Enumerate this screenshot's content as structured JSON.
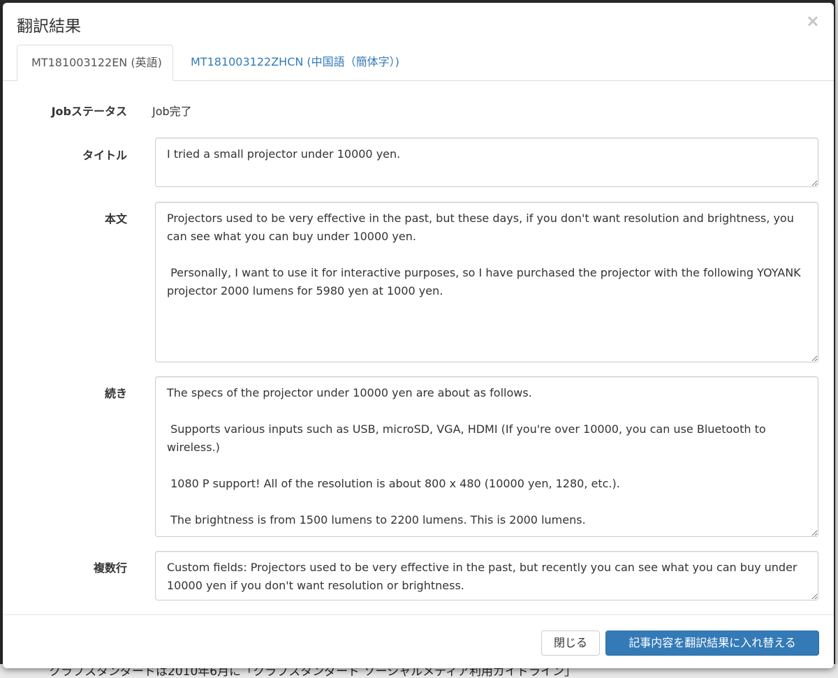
{
  "backdrop": {
    "text": "クラブスタンダードは2010年6月に「クラブスタンダード ソーシャルメディア利用ガイドライン」"
  },
  "modal": {
    "title": "翻訳結果",
    "close_symbol": "×"
  },
  "tabs": [
    {
      "label": "MT181003122EN (英語)",
      "active": true
    },
    {
      "label": "MT181003122ZHCN (中国語（簡体字）)",
      "active": false
    }
  ],
  "form": {
    "job_status": {
      "label": "Jobステータス",
      "value": "Job完了"
    },
    "title": {
      "label": "タイトル",
      "value": "I tried a small projector under 10000 yen."
    },
    "body": {
      "label": "本文",
      "value": "Projectors used to be very effective in the past, but these days, if you don't want resolution and brightness, you can see what you can buy under 10000 yen.\n\n Personally, I want to use it for interactive purposes, so I have purchased the projector with the following YOYANK projector 2000 lumens for 5980 yen at 1000 yen."
    },
    "continuation": {
      "label": "続き",
      "value": "The specs of the projector under 10000 yen are about as follows.\n\n Supports various inputs such as USB, microSD, VGA, HDMI (If you're over 10000, you can use Bluetooth to wireless.)\n\n 1080 P support! All of the resolution is about 800 x 480 (10000 yen, 1280, etc.).\n\n The brightness is from 1500 lumens to 2200 lumens. This is 2000 lumens."
    },
    "multiline": {
      "label": "複数行",
      "value": "Custom fields: Projectors used to be very effective in the past, but recently you can see what you can buy under 10000 yen if you don't want resolution or brightness."
    }
  },
  "footer": {
    "close_label": "閉じる",
    "replace_label": "記事内容を翻訳結果に入れ替える"
  },
  "colors": {
    "primary": "#337ab7",
    "link": "#337ab7",
    "border": "#cccccc"
  }
}
